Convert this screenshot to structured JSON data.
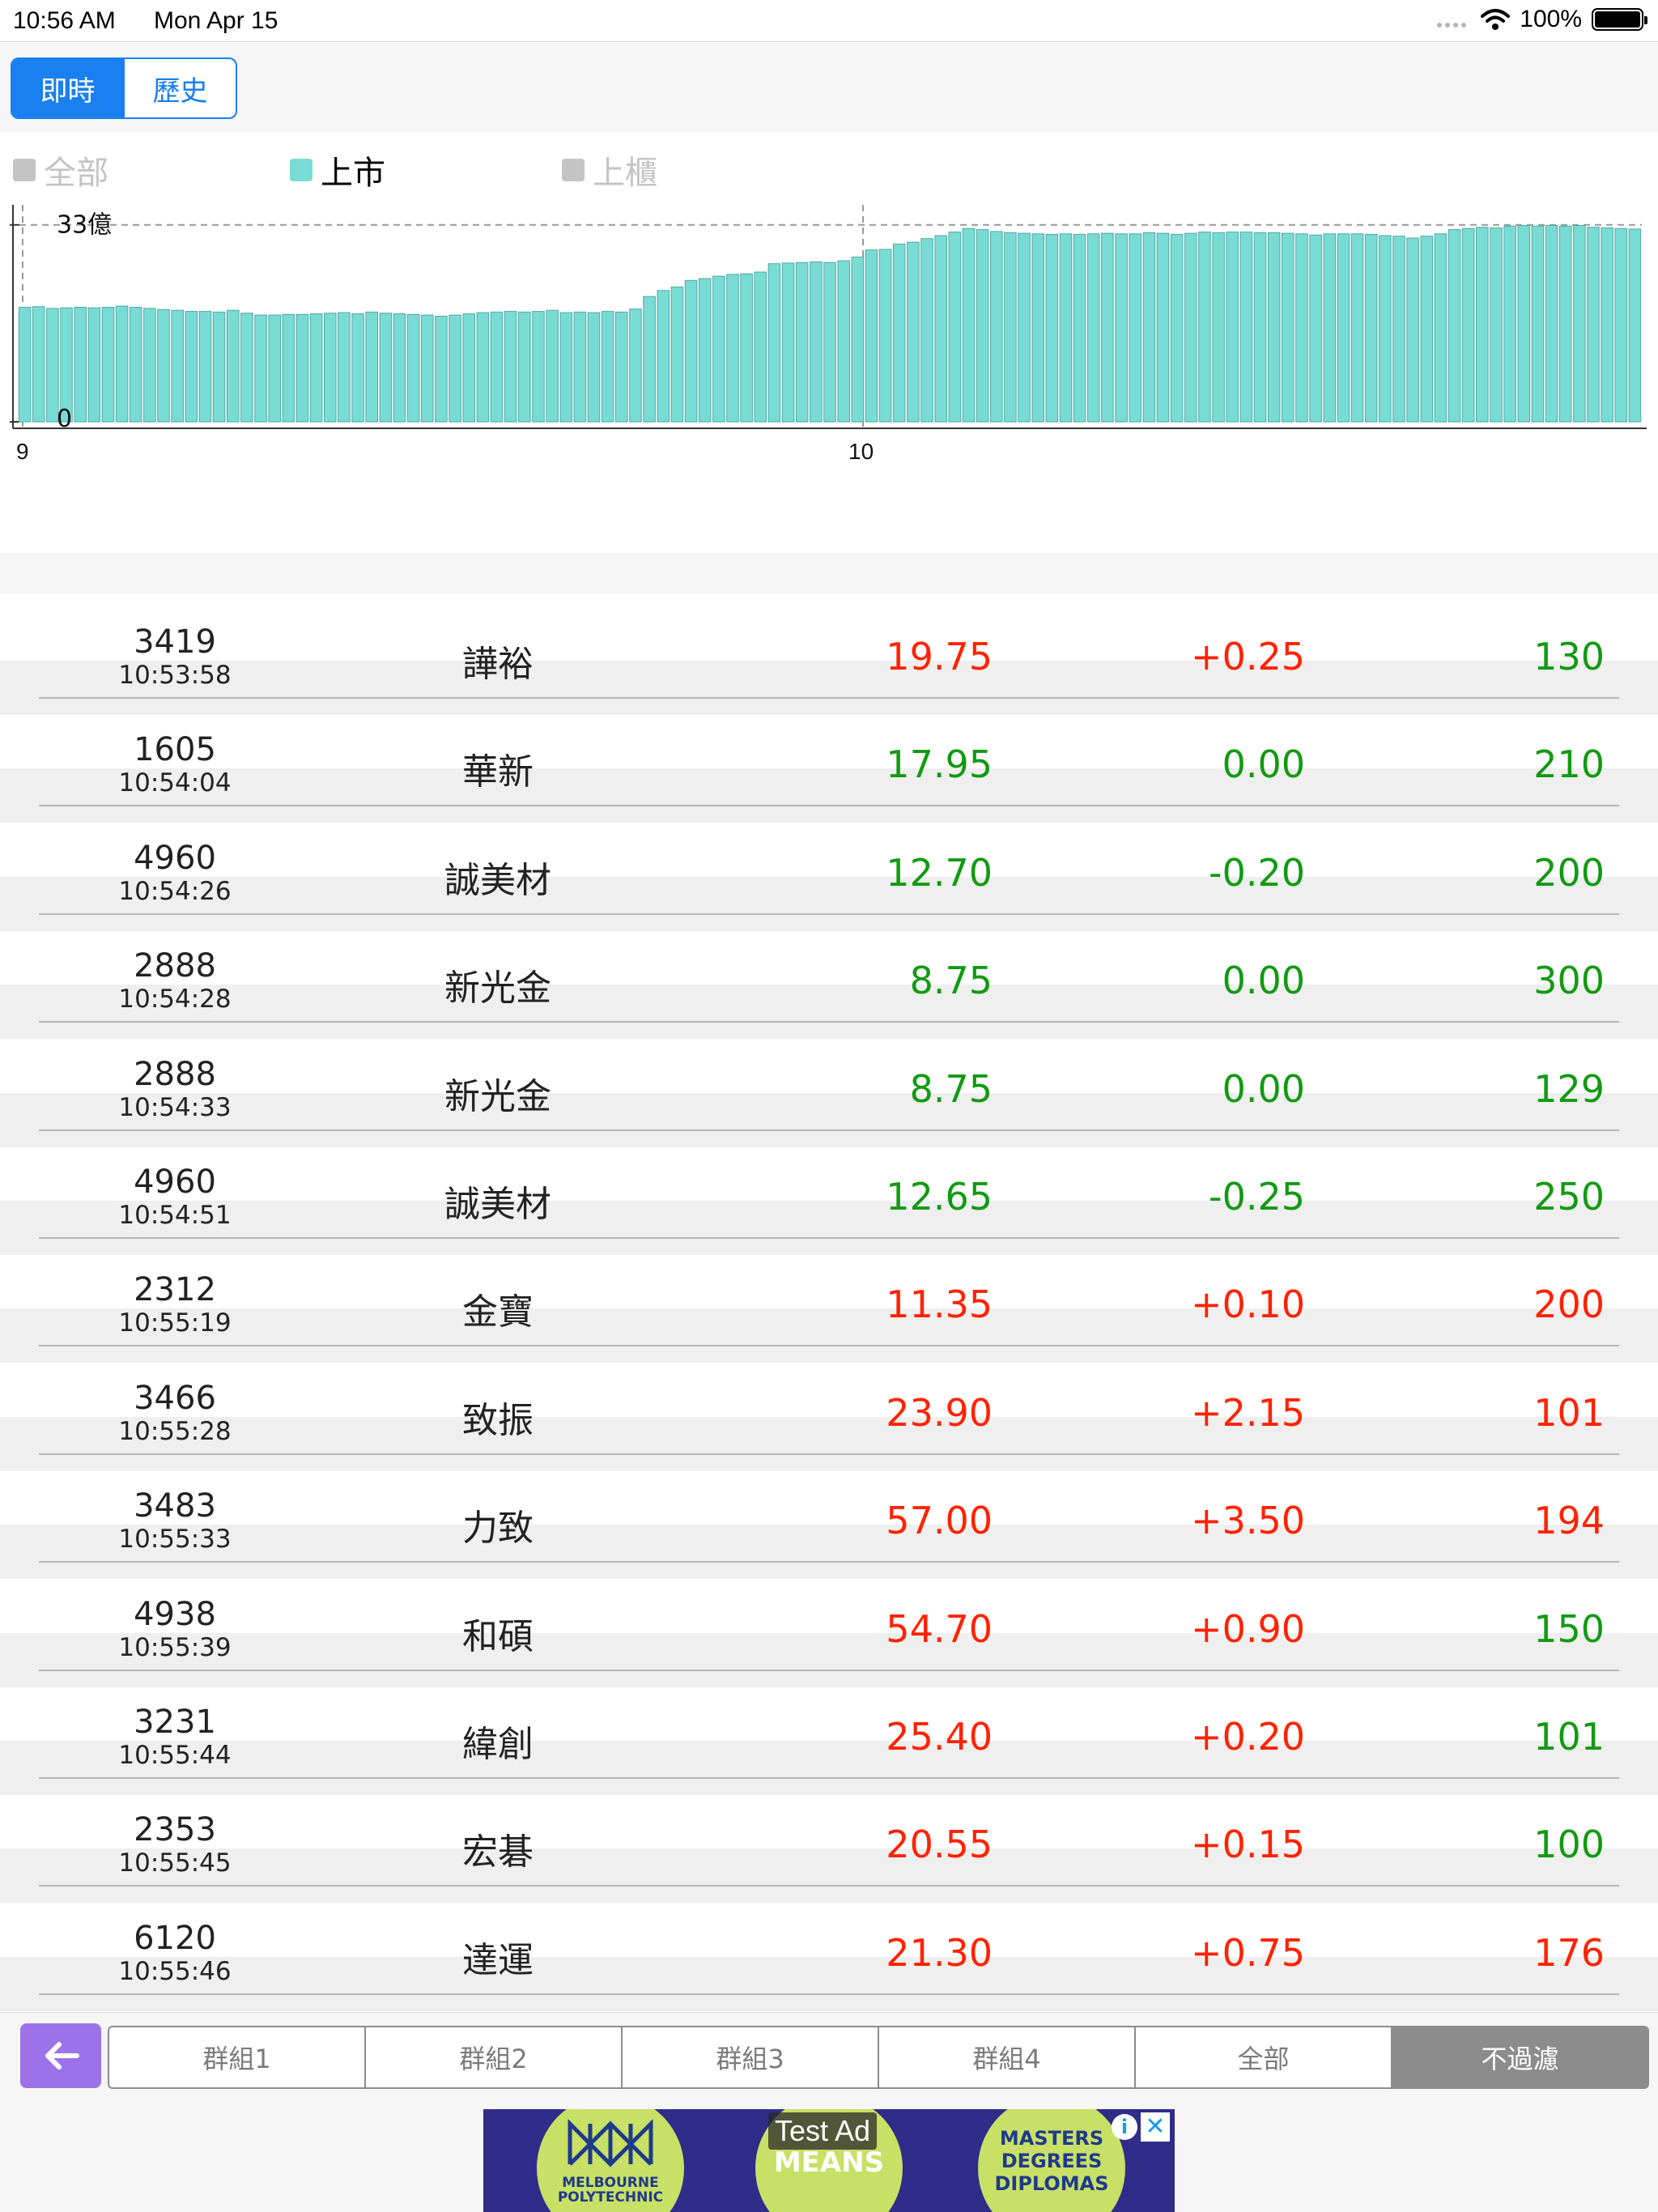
{
  "status_bar": {
    "time": "10:56 AM",
    "date": "Mon Apr 15",
    "battery": "100%"
  },
  "segment": {
    "realtime": "即時",
    "history": "歷史"
  },
  "legend": {
    "all": "全部",
    "listed": "上市",
    "otc": "上櫃"
  },
  "chart_data": {
    "type": "bar",
    "x_tick_labels": [
      "9",
      "10"
    ],
    "y_tick_labels": [
      "33億",
      "0"
    ],
    "ylim": [
      0,
      35
    ],
    "y_reference_line": 33,
    "series": [
      {
        "name": "上市",
        "color": "#78dcd5",
        "values": [
          19.2,
          19.3,
          19.0,
          19.1,
          19.2,
          19.1,
          19.2,
          19.4,
          19.2,
          19.0,
          18.8,
          18.7,
          18.5,
          18.5,
          18.4,
          18.7,
          18.2,
          17.9,
          17.9,
          18.0,
          18.0,
          18.1,
          18.2,
          18.3,
          18.1,
          18.4,
          18.2,
          18.1,
          18.0,
          17.9,
          17.7,
          17.9,
          18.1,
          18.3,
          18.4,
          18.5,
          18.4,
          18.5,
          18.7,
          18.3,
          18.4,
          18.3,
          18.5,
          18.4,
          18.9,
          21.0,
          22.0,
          22.6,
          23.7,
          24.0,
          24.4,
          24.7,
          24.8,
          25.1,
          26.5,
          26.6,
          26.7,
          26.8,
          26.7,
          27.0,
          27.6,
          28.8,
          28.9,
          29.8,
          30.1,
          30.7,
          31.2,
          31.8,
          32.4,
          32.2,
          31.9,
          31.7,
          31.6,
          31.5,
          31.4,
          31.5,
          31.4,
          31.5,
          31.6,
          31.5,
          31.5,
          31.7,
          31.6,
          31.4,
          31.6,
          31.8,
          31.7,
          31.8,
          31.8,
          31.7,
          31.7,
          31.6,
          31.5,
          31.3,
          31.5,
          31.5,
          31.5,
          31.4,
          31.2,
          31.1,
          30.8,
          31.1,
          31.5,
          32.2,
          32.4,
          32.6,
          32.5,
          32.8,
          32.9,
          32.8,
          32.9,
          32.8,
          32.9,
          32.6,
          32.5,
          32.4,
          32.3
        ]
      }
    ],
    "title": "",
    "xlabel": "",
    "ylabel": "",
    "grid": "dashed reference line at 33億 and vertical line at 9 and 10",
    "legend_position": "top-left"
  },
  "table": {
    "rows": [
      {
        "code": "3419",
        "time": "10:53:58",
        "name": "譁裕",
        "price": "19.75",
        "change": "+0.25",
        "volume": "130",
        "price_color": "red",
        "change_color": "red",
        "volume_color": "green"
      },
      {
        "code": "1605",
        "time": "10:54:04",
        "name": "華新",
        "price": "17.95",
        "change": "0.00",
        "volume": "210",
        "price_color": "green",
        "change_color": "green",
        "volume_color": "green"
      },
      {
        "code": "4960",
        "time": "10:54:26",
        "name": "誠美材",
        "price": "12.70",
        "change": "-0.20",
        "volume": "200",
        "price_color": "green",
        "change_color": "green",
        "volume_color": "green"
      },
      {
        "code": "2888",
        "time": "10:54:28",
        "name": "新光金",
        "price": "8.75",
        "change": "0.00",
        "volume": "300",
        "price_color": "green",
        "change_color": "green",
        "volume_color": "green"
      },
      {
        "code": "2888",
        "time": "10:54:33",
        "name": "新光金",
        "price": "8.75",
        "change": "0.00",
        "volume": "129",
        "price_color": "green",
        "change_color": "green",
        "volume_color": "green"
      },
      {
        "code": "4960",
        "time": "10:54:51",
        "name": "誠美材",
        "price": "12.65",
        "change": "-0.25",
        "volume": "250",
        "price_color": "green",
        "change_color": "green",
        "volume_color": "green"
      },
      {
        "code": "2312",
        "time": "10:55:19",
        "name": "金寶",
        "price": "11.35",
        "change": "+0.10",
        "volume": "200",
        "price_color": "red",
        "change_color": "red",
        "volume_color": "red"
      },
      {
        "code": "3466",
        "time": "10:55:28",
        "name": "致振",
        "price": "23.90",
        "change": "+2.15",
        "volume": "101",
        "price_color": "red",
        "change_color": "red",
        "volume_color": "red"
      },
      {
        "code": "3483",
        "time": "10:55:33",
        "name": "力致",
        "price": "57.00",
        "change": "+3.50",
        "volume": "194",
        "price_color": "red",
        "change_color": "red",
        "volume_color": "red"
      },
      {
        "code": "4938",
        "time": "10:55:39",
        "name": "和碩",
        "price": "54.70",
        "change": "+0.90",
        "volume": "150",
        "price_color": "red",
        "change_color": "red",
        "volume_color": "green"
      },
      {
        "code": "3231",
        "time": "10:55:44",
        "name": "緯創",
        "price": "25.40",
        "change": "+0.20",
        "volume": "101",
        "price_color": "red",
        "change_color": "red",
        "volume_color": "green"
      },
      {
        "code": "2353",
        "time": "10:55:45",
        "name": "宏碁",
        "price": "20.55",
        "change": "+0.15",
        "volume": "100",
        "price_color": "red",
        "change_color": "red",
        "volume_color": "green"
      },
      {
        "code": "6120",
        "time": "10:55:46",
        "name": "達運",
        "price": "21.30",
        "change": "+0.75",
        "volume": "176",
        "price_color": "red",
        "change_color": "red",
        "volume_color": "red"
      }
    ]
  },
  "filter_bar": {
    "groups": [
      "群組1",
      "群組2",
      "群組3",
      "群組4",
      "全部",
      "不過濾"
    ],
    "active_index": 5
  },
  "ad": {
    "label": "Test Ad",
    "left_text": "MELBOURNE POLYTECHNIC",
    "center_text": "MEANS",
    "right_text": "MASTERS DEGREES DIPLOMAS"
  },
  "colors": {
    "accent": "#1a7ff0",
    "bar": "#78dcd5",
    "up": "#ff2200",
    "down": "#129a12",
    "back_button": "#9d72e9"
  }
}
